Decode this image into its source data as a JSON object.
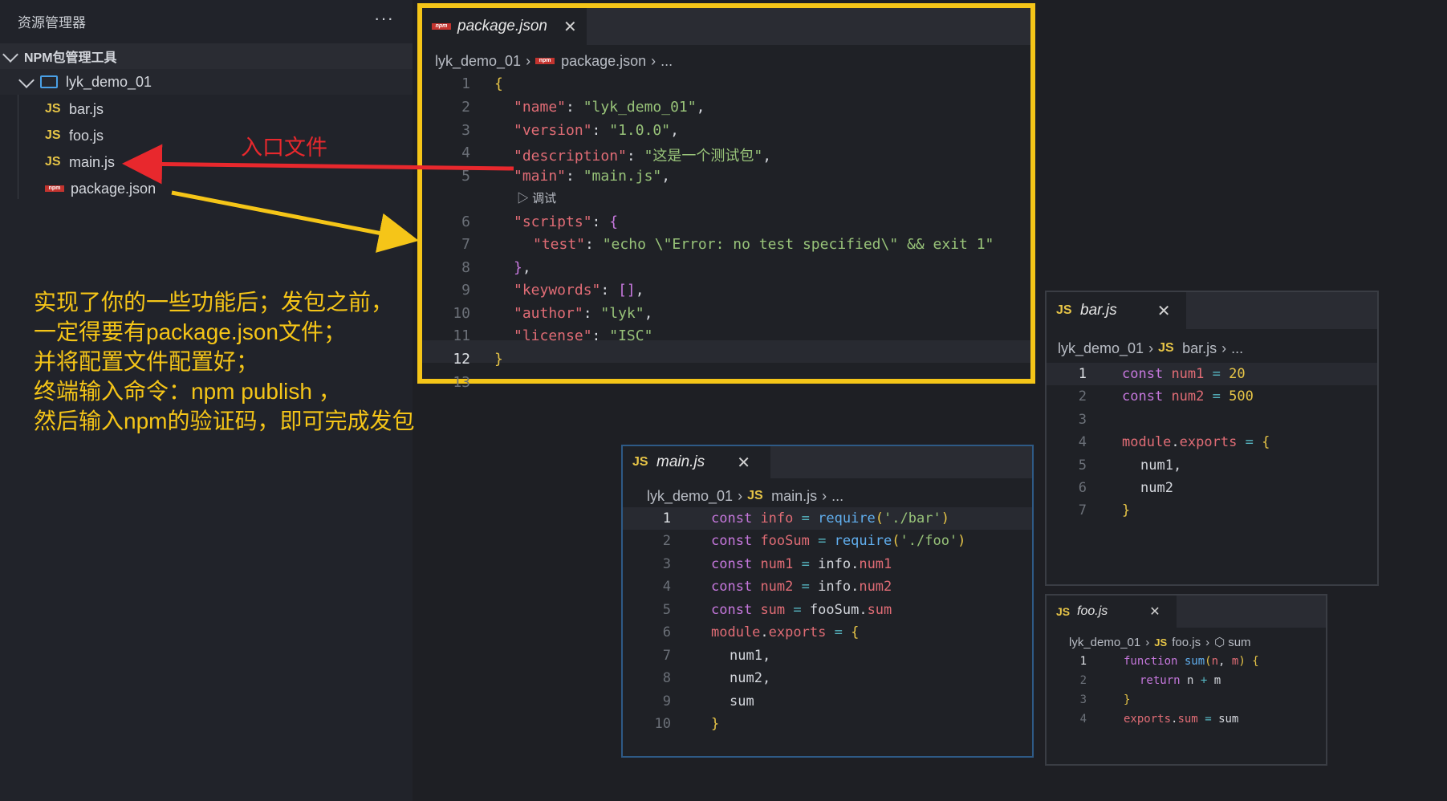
{
  "sidebar": {
    "title": "资源管理器",
    "more": "···",
    "section": "NPM包管理工具",
    "folder": "lyk_demo_01",
    "files": [
      {
        "badge": "JS",
        "name": "bar.js"
      },
      {
        "badge": "JS",
        "name": "foo.js"
      },
      {
        "badge": "JS",
        "name": "main.js"
      },
      {
        "badge": "npm",
        "name": "package.json"
      }
    ]
  },
  "package_editor": {
    "tab": "package.json",
    "close": "✕",
    "breadcrumb": [
      "lyk_demo_01",
      "package.json",
      "..."
    ],
    "debug_label": "调试",
    "line_numbers": [
      "1",
      "2",
      "3",
      "4",
      "5",
      "6",
      "7",
      "8",
      "9",
      "10",
      "11",
      "12",
      "13"
    ],
    "lines": {
      "l1": "{",
      "name_key": "\"name\"",
      "name_val": "\"lyk_demo_01\"",
      "version_key": "\"version\"",
      "version_val": "\"1.0.0\"",
      "desc_key": "\"description\"",
      "desc_val": "\"这是一个测试包\"",
      "main_key": "\"main\"",
      "main_val": "\"main.js\"",
      "scripts_key": "\"scripts\"",
      "test_key": "\"test\"",
      "test_val": "\"echo \\\"Error: no test specified\\\" && exit 1\"",
      "keywords_key": "\"keywords\"",
      "author_key": "\"author\"",
      "author_val": "\"lyk\"",
      "license_key": "\"license\"",
      "license_val": "\"ISC\"",
      "end": "}"
    }
  },
  "bar_editor": {
    "tab": "bar.js",
    "breadcrumb": [
      "lyk_demo_01",
      "bar.js",
      "..."
    ],
    "line_numbers": [
      "1",
      "2",
      "3",
      "4",
      "5",
      "6",
      "7"
    ],
    "num1_val": "20",
    "num2_val": "500"
  },
  "main_js_editor": {
    "tab": "main.js",
    "breadcrumb": [
      "lyk_demo_01",
      "main.js",
      "..."
    ],
    "line_numbers": [
      "1",
      "2",
      "3",
      "4",
      "5",
      "6",
      "7",
      "8",
      "9",
      "10"
    ],
    "require_bar": "'./bar'",
    "require_foo": "'./foo'"
  },
  "foo_editor": {
    "tab": "foo.js",
    "breadcrumb": [
      "lyk_demo_01",
      "foo.js",
      "sum"
    ],
    "line_numbers": [
      "1",
      "2",
      "3",
      "4"
    ]
  },
  "annotations": {
    "entry_label": "入口文件",
    "note": "实现了你的一些功能后；发包之前，\n一定得要有package.json文件；\n并将配置文件配置好；\n终端输入命令：npm publish ，\n然后输入npm的验证码，即可完成发包"
  },
  "colors": {
    "highlight_box": "#f5c518",
    "arrow_red": "#e8282d",
    "arrow_yellow": "#f5c518"
  }
}
